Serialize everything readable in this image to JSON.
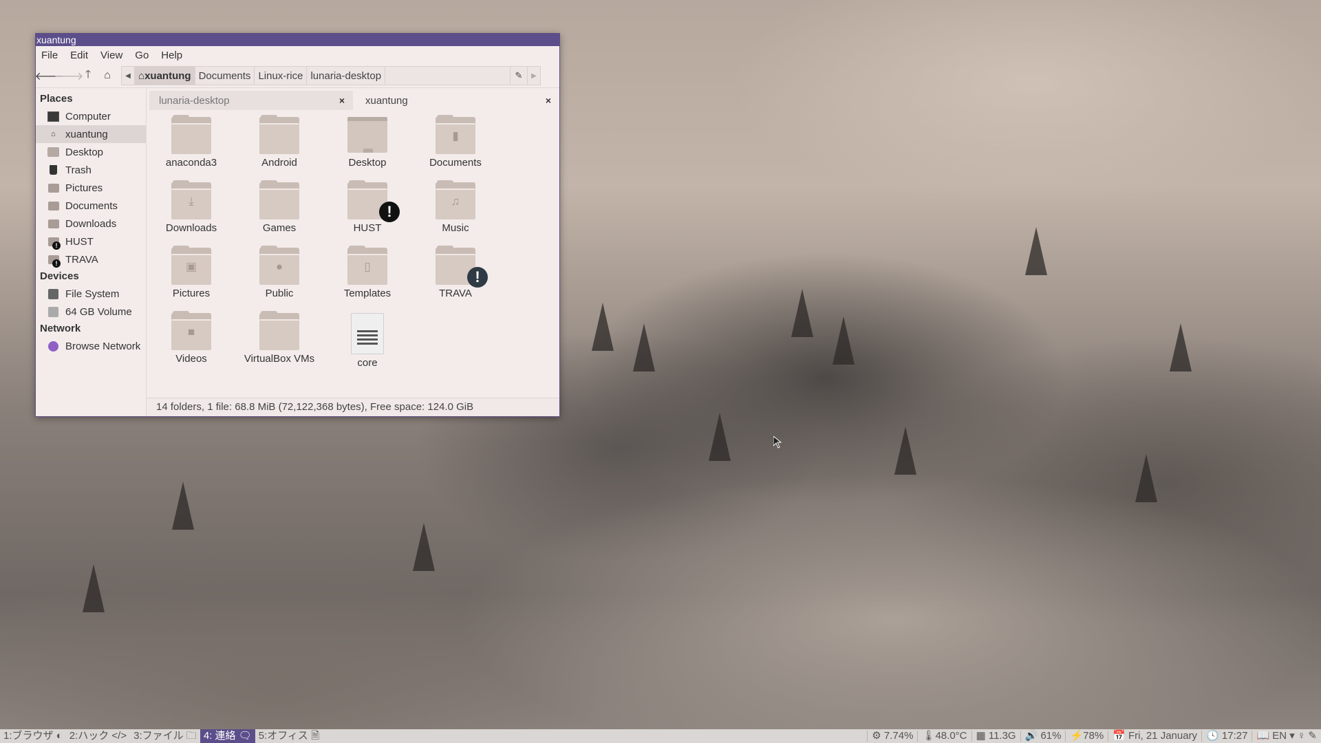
{
  "window": {
    "title": "xuantung"
  },
  "menu": [
    "File",
    "Edit",
    "View",
    "Go",
    "Help"
  ],
  "path": [
    "xuantung",
    "Documents",
    "Linux-rice",
    "lunaria-desktop"
  ],
  "sidebar": {
    "places_header": "Places",
    "places": [
      {
        "label": "Computer",
        "icon": "monitor-icon"
      },
      {
        "label": "xuantung",
        "icon": "home-icon"
      },
      {
        "label": "Desktop",
        "icon": "desktop-icon"
      },
      {
        "label": "Trash",
        "icon": "trash-icon"
      },
      {
        "label": "Pictures",
        "icon": "folder-icon"
      },
      {
        "label": "Documents",
        "icon": "folder-icon"
      },
      {
        "label": "Downloads",
        "icon": "folder-icon"
      },
      {
        "label": "HUST",
        "icon": "folder-warning-icon"
      },
      {
        "label": "TRAVA",
        "icon": "folder-warning-icon"
      }
    ],
    "devices_header": "Devices",
    "devices": [
      {
        "label": "File System",
        "icon": "disk-icon"
      },
      {
        "label": "64 GB Volume",
        "icon": "disk-icon"
      }
    ],
    "network_header": "Network",
    "network": [
      {
        "label": "Browse Network",
        "icon": "network-icon"
      }
    ]
  },
  "tabs": [
    {
      "label": "lunaria-desktop",
      "close": "×"
    },
    {
      "label": "xuantung",
      "close": "×"
    }
  ],
  "files": [
    "anaconda3",
    "Android",
    "Desktop",
    "Documents",
    "Downloads",
    "Games",
    "HUST",
    "Music",
    "Pictures",
    "Public",
    "Templates",
    "TRAVA",
    "Videos",
    "VirtualBox VMs",
    "core"
  ],
  "status": "14 folders, 1 file: 68.8 MiB (72,122,368 bytes), Free space: 124.0 GiB",
  "panel": {
    "workspaces": [
      "1:ブラウザ ◐",
      "2:ハック </>",
      "3:ファイル 🗀",
      "4: 連絡 🗨",
      "5:オフィス 🗎"
    ],
    "cpu": "⚙ 7.74%",
    "temp": "🌡48.0°C",
    "mem": "▦ 11.3G",
    "volume": "🔊 61%",
    "battery": "⚡78%",
    "date": "📅 Fri, 21 January",
    "time": "🕓 17:27",
    "tray": "📖 EN ▾ ♀ ✎"
  },
  "colors": {
    "accent": "#5b4e8a",
    "window_bg": "#f3eceb",
    "folder": "#d6cac2"
  }
}
